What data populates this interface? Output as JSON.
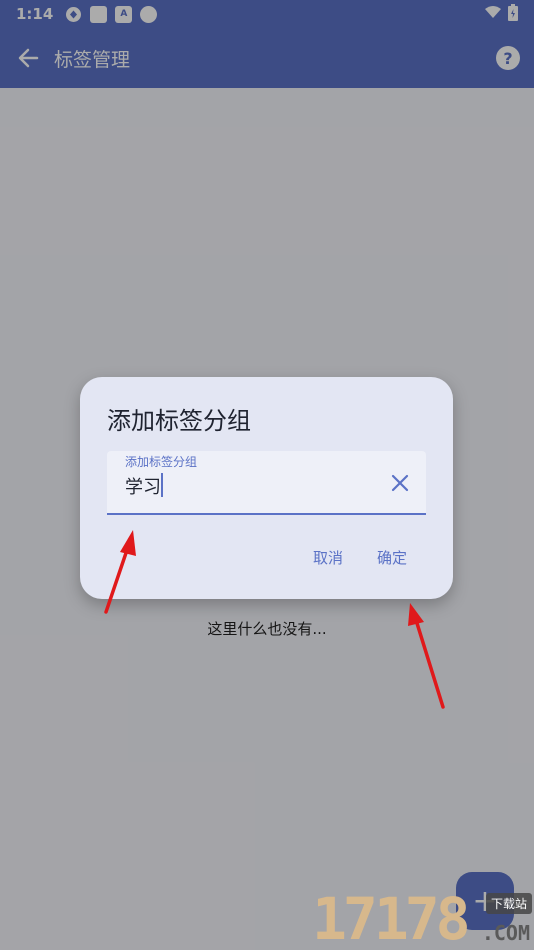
{
  "status_bar": {
    "time": "1:14",
    "a_icon_letter": "A"
  },
  "app_bar": {
    "title": "标签管理",
    "help_glyph": "?"
  },
  "empty_state": "这里什么也没有...",
  "fab": {
    "glyph": "+"
  },
  "dialog": {
    "title": "添加标签分组",
    "field_label": "添加标签分组",
    "field_value": "学习",
    "cancel": "取消",
    "confirm": "确定"
  },
  "watermark": {
    "number": "17178",
    "badge": "下载站",
    "com": ".COM"
  },
  "colors": {
    "primary": "#5b72c6",
    "scrim": "rgba(0,0,0,0.33)",
    "dialog_bg": "#e3e6f3",
    "arrow": "#e0191b"
  }
}
